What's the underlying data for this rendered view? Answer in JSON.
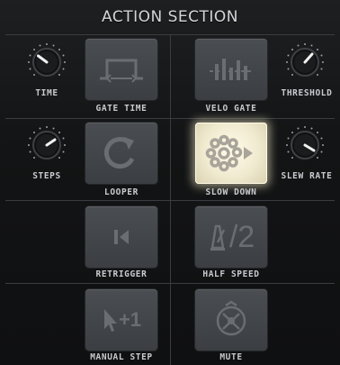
{
  "section_title": "ACTION SECTION",
  "knobs": {
    "time": {
      "label": "TIME"
    },
    "threshold": {
      "label": "THRESHOLD"
    },
    "steps": {
      "label": "STEPS"
    },
    "slew_rate": {
      "label": "SLEW RATE"
    }
  },
  "buttons": {
    "gate_time": {
      "label": "GATE TIME",
      "icon": "gate-time-icon",
      "active": false
    },
    "velo_gate": {
      "label": "VELO GATE",
      "icon": "velo-gate-icon",
      "active": false
    },
    "looper": {
      "label": "LOOPER",
      "icon": "loop-arrow-icon",
      "active": false
    },
    "slow_down": {
      "label": "SLOW DOWN",
      "icon": "slow-down-icon",
      "active": true
    },
    "retrigger": {
      "label": "RETRIGGER",
      "icon": "retrigger-icon",
      "active": false
    },
    "half_speed": {
      "label": "HALF SPEED",
      "icon": "half-speed-icon",
      "active": false,
      "glyph": "/2"
    },
    "manual_step": {
      "label": "MANUAL STEP",
      "icon": "manual-step-icon",
      "active": false,
      "glyph": "+1"
    },
    "mute": {
      "label": "MUTE",
      "icon": "mute-icon",
      "active": false
    }
  },
  "colors": {
    "button_idle": "#44474b",
    "button_active": "#f5f0dc",
    "icon_idle": "#6a6e73",
    "label": "#c8cbcf"
  }
}
